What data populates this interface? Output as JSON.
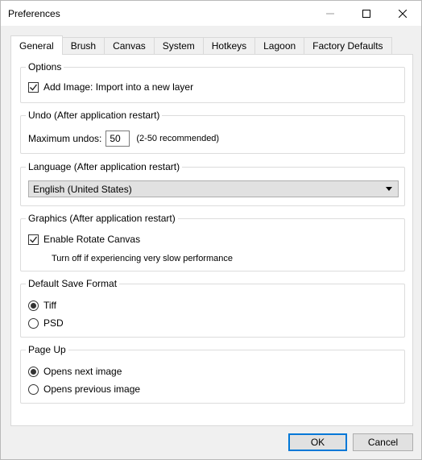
{
  "window": {
    "title": "Preferences"
  },
  "tabs": [
    {
      "label": "General",
      "active": true
    },
    {
      "label": "Brush",
      "active": false
    },
    {
      "label": "Canvas",
      "active": false
    },
    {
      "label": "System",
      "active": false
    },
    {
      "label": "Hotkeys",
      "active": false
    },
    {
      "label": "Lagoon",
      "active": false
    },
    {
      "label": "Factory Defaults",
      "active": false
    }
  ],
  "options": {
    "title": "Options",
    "add_image_label": "Add Image: Import into a new layer",
    "add_image_checked": true
  },
  "undo": {
    "title": "Undo (After application restart)",
    "max_label": "Maximum undos:",
    "max_value": "50",
    "hint": "(2-50 recommended)"
  },
  "language": {
    "title": "Language (After application restart)",
    "selected": "English (United States)"
  },
  "graphics": {
    "title": "Graphics (After application restart)",
    "rotate_label": "Enable Rotate Canvas",
    "rotate_checked": true,
    "note": "Turn off if experiencing very slow performance"
  },
  "save_format": {
    "title": "Default Save Format",
    "options": [
      "Tiff",
      "PSD"
    ],
    "selected": "Tiff"
  },
  "page_up": {
    "title": "Page Up",
    "options": [
      "Opens next image",
      "Opens previous image"
    ],
    "selected": "Opens next image"
  },
  "buttons": {
    "ok": "OK",
    "cancel": "Cancel"
  },
  "colors": {
    "accent": "#0078d7",
    "window_bg": "#f0f0f0",
    "panel_bg": "#ffffff"
  }
}
